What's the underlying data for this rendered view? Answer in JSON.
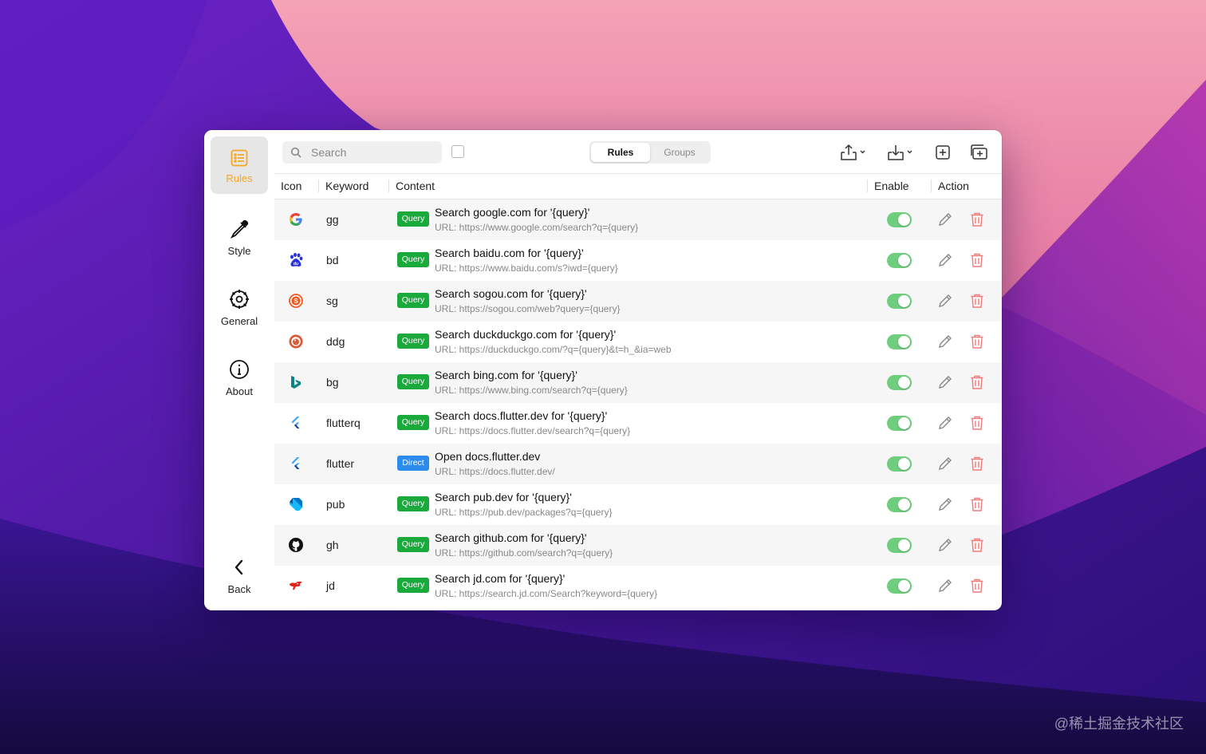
{
  "sidebar": {
    "items": [
      {
        "label": "Rules",
        "icon": "list-icon",
        "active": true
      },
      {
        "label": "Style",
        "icon": "eyedropper-icon"
      },
      {
        "label": "General",
        "icon": "gear-icon"
      },
      {
        "label": "About",
        "icon": "info-icon"
      }
    ],
    "back_label": "Back"
  },
  "toolbar": {
    "search_placeholder": "Search",
    "tabs": [
      "Rules",
      "Groups"
    ],
    "active_tab": "Rules",
    "buttons": [
      "export-icon",
      "import-icon",
      "add-icon",
      "add-group-icon"
    ]
  },
  "table": {
    "columns": [
      "Icon",
      "Keyword",
      "Content",
      "Enable",
      "Action"
    ],
    "rows": [
      {
        "keyword": "gg",
        "type": "Query",
        "title": "Search google.com for '{query}'",
        "url": "URL: https://www.google.com/search?q={query}",
        "icon": "google-icon",
        "enabled": true
      },
      {
        "keyword": "bd",
        "type": "Query",
        "title": "Search baidu.com for '{query}'",
        "url": "URL: https://www.baidu.com/s?iwd={query}",
        "icon": "baidu-icon",
        "enabled": true
      },
      {
        "keyword": "sg",
        "type": "Query",
        "title": "Search sogou.com for '{query}'",
        "url": "URL: https://sogou.com/web?query={query}",
        "icon": "sogou-icon",
        "enabled": true
      },
      {
        "keyword": "ddg",
        "type": "Query",
        "title": "Search duckduckgo.com for '{query}'",
        "url": "URL: https://duckduckgo.com/?q={query}&t=h_&ia=web",
        "icon": "duckduckgo-icon",
        "enabled": true
      },
      {
        "keyword": "bg",
        "type": "Query",
        "title": "Search bing.com for '{query}'",
        "url": "URL: https://www.bing.com/search?q={query}",
        "icon": "bing-icon",
        "enabled": true
      },
      {
        "keyword": "flutterq",
        "type": "Query",
        "title": "Search docs.flutter.dev for '{query}'",
        "url": "URL: https://docs.flutter.dev/search?q={query}",
        "icon": "flutter-icon",
        "enabled": true
      },
      {
        "keyword": "flutter",
        "type": "Direct",
        "title": "Open docs.flutter.dev",
        "url": "URL: https://docs.flutter.dev/",
        "icon": "flutter-icon",
        "enabled": true
      },
      {
        "keyword": "pub",
        "type": "Query",
        "title": "Search pub.dev for '{query}'",
        "url": "URL: https://pub.dev/packages?q={query}",
        "icon": "dart-icon",
        "enabled": true
      },
      {
        "keyword": "gh",
        "type": "Query",
        "title": "Search github.com for '{query}'",
        "url": "URL: https://github.com/search?q={query}",
        "icon": "github-icon",
        "enabled": true
      },
      {
        "keyword": "jd",
        "type": "Query",
        "title": "Search jd.com for '{query}'",
        "url": "URL: https://search.jd.com/Search?keyword={query}",
        "icon": "jd-icon",
        "enabled": true
      }
    ]
  },
  "watermark": "@稀土掘金技术社区",
  "colors": {
    "accent": "#f5a623",
    "query": "#1aaa3c",
    "direct": "#2b8cee",
    "toggle": "#6fce7e",
    "delete": "#f07a7a"
  }
}
